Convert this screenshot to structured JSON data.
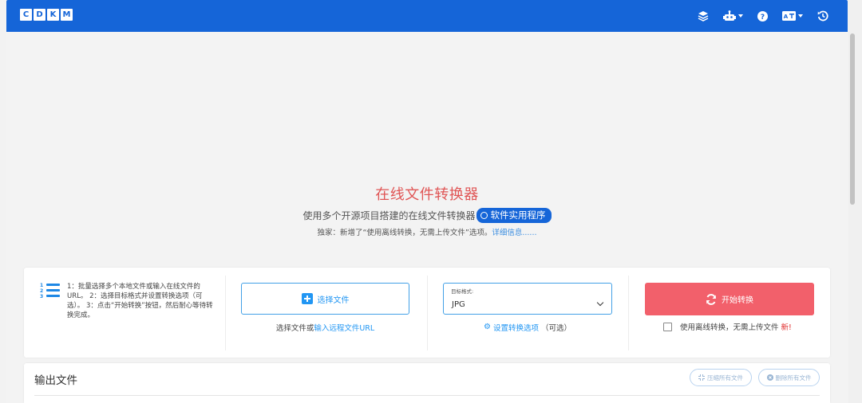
{
  "header": {
    "logo_letters": [
      "C",
      "D",
      "K",
      "M"
    ],
    "icons": [
      "layers-icon",
      "robot-icon",
      "help-icon",
      "language-icon",
      "history-icon"
    ],
    "accent_color": "#1565d8"
  },
  "hero": {
    "title": "在线文件转换器",
    "subtitle": "使用多个开源项目搭建的在线文件转换器",
    "badge_label": "软件实用程序",
    "note_prefix": "独家：新增了“使用离线转换，无需上传文件”选项。",
    "note_link": "详细信息......"
  },
  "steps": {
    "text": "1：批量选择多个本地文件或输入在线文件的URL。 2：选择目标格式并设置转换选项（可选）。 3：点击“开始转换”按钮，然后耐心等待转换完成。"
  },
  "file_select": {
    "button_label": "选择文件",
    "caption_prefix": "选择文件或",
    "caption_link": "输入远程文件URL"
  },
  "format": {
    "label": "目标格式:",
    "value": "JPG",
    "options_link": "设置转换选项",
    "options_suffix": "（可选）"
  },
  "convert": {
    "button_label": "开始转换",
    "offline_label": "使用离线转换，无需上传文件",
    "new_tag": "新!",
    "offline_checked": false,
    "button_color": "#f2606b"
  },
  "output": {
    "title": "输出文件",
    "compress_all": "压缩所有文件",
    "delete_all": "删除所有文件"
  }
}
